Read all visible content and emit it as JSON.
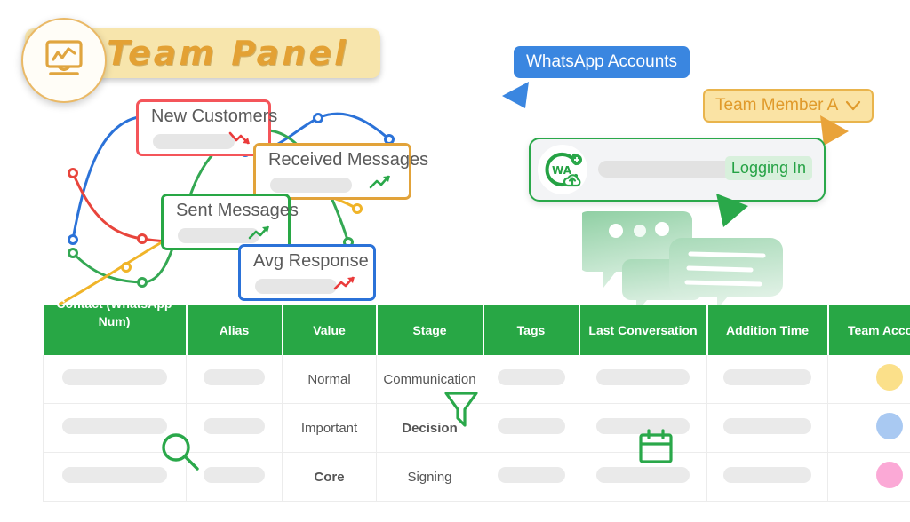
{
  "header": {
    "title": "Team Panel",
    "logo_icon": "monitor-chart-icon"
  },
  "metrics": [
    {
      "id": "new_customers",
      "label": "New Customers",
      "trend": "down",
      "color": "#f4555a"
    },
    {
      "id": "received_messages",
      "label": "Received Messages",
      "trend": "up",
      "color": "#e2a33a"
    },
    {
      "id": "sent_messages",
      "label": "Sent Messages",
      "trend": "up",
      "color": "#28a745"
    },
    {
      "id": "avg_response",
      "label": "Avg Response",
      "trend": "up",
      "color": "#2b72d8"
    }
  ],
  "whatsapp": {
    "accounts_badge": "WhatsApp Accounts",
    "team_member_select": "Team Member A",
    "chevron_icon": "chevron-down-icon",
    "account_logo": "whatsapp-wa-logo-icon",
    "cloud_icon": "cloud-upload-icon",
    "plus_icon": "plus-badge-icon",
    "status": "Logging In",
    "status_color": "#25a244"
  },
  "table": {
    "columns": [
      "Contact (WhatsApp Num)",
      "Alias",
      "Value",
      "Stage",
      "Tags",
      "Last Conversation",
      "Addition Time",
      "Team Account"
    ],
    "rows": [
      {
        "contact": "",
        "alias": "",
        "value": "Normal",
        "value_strong": false,
        "stage": "Communication",
        "stage_strong": false,
        "tags": "",
        "last_conversation": "",
        "addition_time": "",
        "team_account_color": "#fbe08a"
      },
      {
        "contact": "",
        "alias": "",
        "value": "Important",
        "value_strong": false,
        "stage": "Decision",
        "stage_strong": true,
        "tags": "",
        "last_conversation": "",
        "addition_time": "",
        "team_account_color": "#a9c9f2"
      },
      {
        "contact": "",
        "alias": "",
        "value": "Core",
        "value_strong": true,
        "stage": "Signing",
        "stage_strong": false,
        "tags": "",
        "last_conversation": "",
        "addition_time": "",
        "team_account_color": "#fba9d6"
      }
    ]
  },
  "decor_icons": {
    "search": "search-icon",
    "filter": "funnel-filter-icon",
    "calendar": "calendar-icon"
  },
  "chart_data": {
    "type": "line",
    "title": "",
    "xlabel": "",
    "ylabel": "",
    "grid": false,
    "legend": "none",
    "x": [
      1,
      2,
      3,
      4,
      5,
      6
    ],
    "series": [
      {
        "name": "New Customers",
        "color": "#2b72d8",
        "values": [
          18,
          72,
          88,
          80,
          90,
          74
        ]
      },
      {
        "name": "Received Messages",
        "color": "#e8453c",
        "values": [
          77,
          38,
          38,
          40,
          62,
          63
        ]
      },
      {
        "name": "Sent Messages",
        "color": "#34a853",
        "values": [
          42,
          26,
          14,
          70,
          86,
          30
        ]
      },
      {
        "name": "Avg Response",
        "color": "#f0b429",
        "values": [
          2,
          20,
          38,
          56,
          60,
          47
        ]
      }
    ],
    "ylim": [
      0,
      100
    ],
    "xlim": [
      1,
      6
    ]
  }
}
